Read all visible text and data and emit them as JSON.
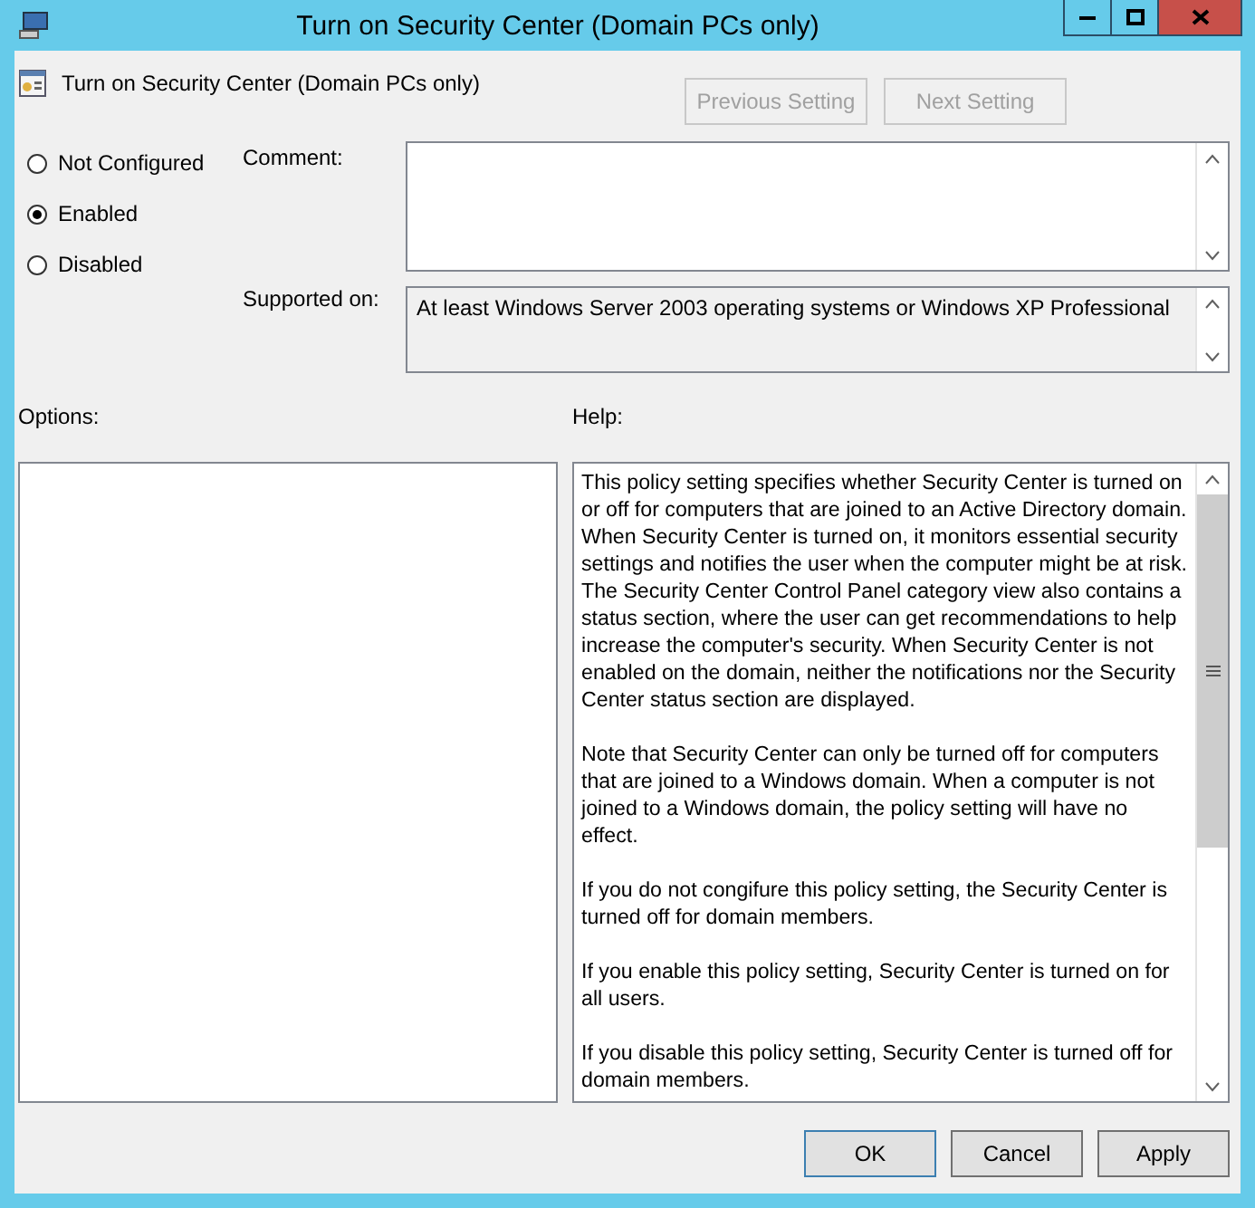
{
  "window": {
    "title": "Turn on Security Center (Domain PCs only)"
  },
  "header": {
    "title": "Turn on Security Center (Domain PCs only)"
  },
  "nav_buttons": [
    {
      "label": "Previous Setting",
      "disabled": true
    },
    {
      "label": "Next Setting",
      "disabled": true
    }
  ],
  "states": [
    {
      "label": "Not Configured",
      "selected": false
    },
    {
      "label": "Enabled",
      "selected": true
    },
    {
      "label": "Disabled",
      "selected": false
    }
  ],
  "comment": {
    "label": "Comment:"
  },
  "supported_on": {
    "label": "Supported on:",
    "value": "At least Windows Server 2003 operating systems or Windows XP Professional"
  },
  "options": {
    "label": "Options:"
  },
  "help": {
    "label": "Help:",
    "paragraphs": [
      "This policy setting specifies whether Security Center is turned on or off for computers that are joined to an Active Directory domain. When Security Center is turned on, it monitors essential security settings and notifies the user when the computer might be at risk. The Security Center Control Panel category view also contains a status section, where the user can get recommendations to help increase the computer's security. When Security Center is not enabled on the domain, neither the notifications nor the Security Center status section are displayed.",
      "Note that Security Center can only be turned off for computers that are joined to a Windows domain. When a computer is not joined to a Windows domain, the policy setting will have no effect.",
      "If you do not congifure this policy setting, the Security Center is turned off for domain members.",
      "If you enable this policy setting, Security Center is turned on for all users.",
      "If you disable this policy setting, Security Center is turned off for domain members."
    ]
  },
  "buttons": [
    {
      "label": "OK",
      "default": true
    },
    {
      "label": "Cancel",
      "default": false
    },
    {
      "label": "Apply",
      "default": false
    }
  ]
}
